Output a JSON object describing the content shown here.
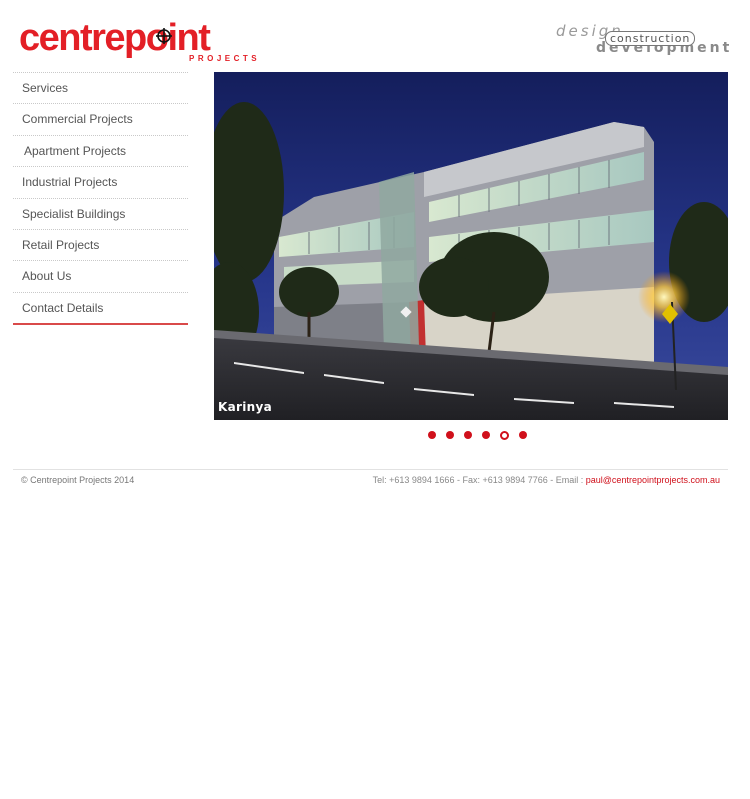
{
  "brand": {
    "logo_text": "centrepoint",
    "logo_sub": "PROJECTS",
    "tagline_design": "design",
    "tagline_construction": "construction",
    "tagline_development": "development",
    "accent_color": "#e31f26"
  },
  "nav": {
    "items": [
      {
        "label": "Services"
      },
      {
        "label": "Commercial Projects"
      },
      {
        "label": "Apartment Projects"
      },
      {
        "label": "Industrial Projects"
      },
      {
        "label": "Specialist Buildings"
      },
      {
        "label": "Retail Projects"
      },
      {
        "label": "About Us"
      },
      {
        "label": "Contact Details"
      }
    ]
  },
  "slideshow": {
    "caption": "Karinya",
    "total_slides": 6,
    "active_slide": 5
  },
  "footer": {
    "copyright": "© Centrepoint Projects 2014",
    "contact_prefix": "Tel: +613 9894 1666 - Fax: +613 9894 7766 - Email : ",
    "email": "paul@centrepointprojects.com.au"
  }
}
